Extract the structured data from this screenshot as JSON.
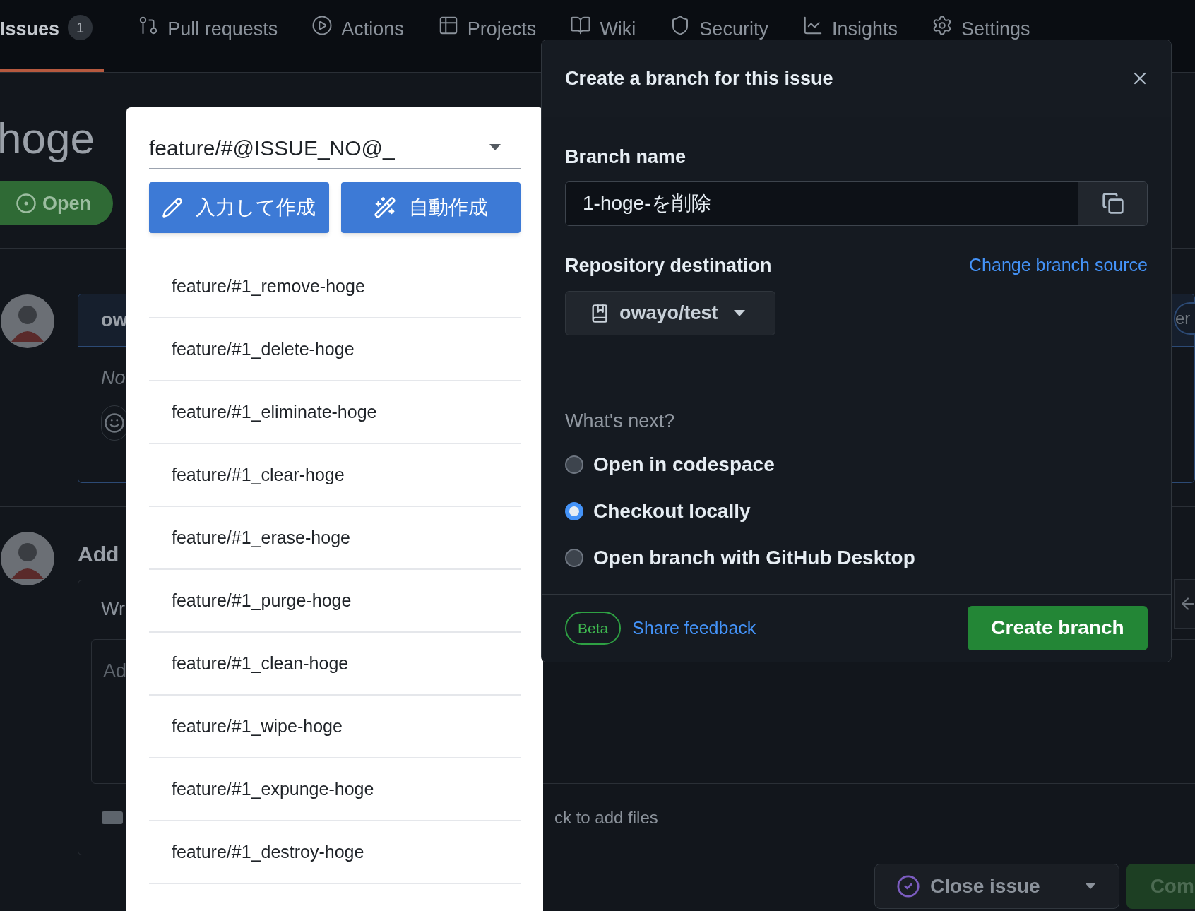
{
  "nav": {
    "tabs": [
      {
        "label": "Issues",
        "count": "1",
        "selected": true
      },
      {
        "label": "Pull requests",
        "selected": false
      },
      {
        "label": "Actions",
        "selected": false
      },
      {
        "label": "Projects",
        "selected": false
      },
      {
        "label": "Wiki",
        "selected": false
      },
      {
        "label": "Security",
        "selected": false
      },
      {
        "label": "Insights",
        "selected": false
      },
      {
        "label": "Settings",
        "selected": false
      }
    ]
  },
  "issue": {
    "title": "hoge",
    "state": "Open",
    "comment": {
      "author": "ow",
      "body": "No"
    },
    "add_comment": {
      "heading": "Add",
      "tab": "Wr",
      "placeholder": "Ad",
      "attach_hint": "ck to add files"
    },
    "side_button": "er",
    "close_button": "Close issue",
    "comment_button": "Com"
  },
  "template_picker": {
    "value": "feature/#@ISSUE_NO@_",
    "buttons": [
      {
        "label": "入力して作成",
        "kind": "pencil"
      },
      {
        "label": "自動作成",
        "kind": "wand"
      }
    ],
    "suggestions": [
      "feature/#1_remove-hoge",
      "feature/#1_delete-hoge",
      "feature/#1_eliminate-hoge",
      "feature/#1_clear-hoge",
      "feature/#1_erase-hoge",
      "feature/#1_purge-hoge",
      "feature/#1_clean-hoge",
      "feature/#1_wipe-hoge",
      "feature/#1_expunge-hoge",
      "feature/#1_destroy-hoge"
    ]
  },
  "dialog": {
    "title": "Create a branch for this issue",
    "branch_name_label": "Branch name",
    "branch_name": "1-hoge-を削除",
    "repo_label": "Repository destination",
    "change_source": "Change branch source",
    "repo": "owayo/test",
    "next_label": "What's next?",
    "options": [
      {
        "label": "Open in codespace",
        "selected": false
      },
      {
        "label": "Checkout locally",
        "selected": true
      },
      {
        "label": "Open branch with GitHub Desktop",
        "selected": false
      }
    ],
    "badge": "Beta",
    "feedback": "Share feedback",
    "create_button": "Create branch"
  }
}
